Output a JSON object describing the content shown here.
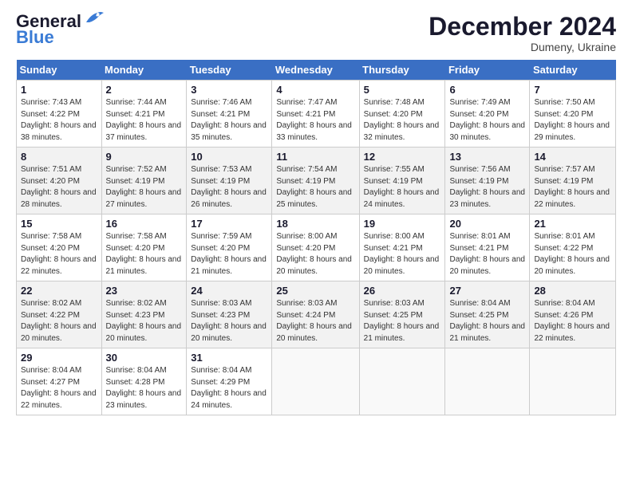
{
  "header": {
    "logo_line1": "General",
    "logo_line2": "Blue",
    "month": "December 2024",
    "location": "Dumeny, Ukraine"
  },
  "weekdays": [
    "Sunday",
    "Monday",
    "Tuesday",
    "Wednesday",
    "Thursday",
    "Friday",
    "Saturday"
  ],
  "weeks": [
    [
      {
        "day": "1",
        "sunrise": "7:43 AM",
        "sunset": "4:22 PM",
        "daylight": "8 hours and 38 minutes."
      },
      {
        "day": "2",
        "sunrise": "7:44 AM",
        "sunset": "4:21 PM",
        "daylight": "8 hours and 37 minutes."
      },
      {
        "day": "3",
        "sunrise": "7:46 AM",
        "sunset": "4:21 PM",
        "daylight": "8 hours and 35 minutes."
      },
      {
        "day": "4",
        "sunrise": "7:47 AM",
        "sunset": "4:21 PM",
        "daylight": "8 hours and 33 minutes."
      },
      {
        "day": "5",
        "sunrise": "7:48 AM",
        "sunset": "4:20 PM",
        "daylight": "8 hours and 32 minutes."
      },
      {
        "day": "6",
        "sunrise": "7:49 AM",
        "sunset": "4:20 PM",
        "daylight": "8 hours and 30 minutes."
      },
      {
        "day": "7",
        "sunrise": "7:50 AM",
        "sunset": "4:20 PM",
        "daylight": "8 hours and 29 minutes."
      }
    ],
    [
      {
        "day": "8",
        "sunrise": "7:51 AM",
        "sunset": "4:20 PM",
        "daylight": "8 hours and 28 minutes."
      },
      {
        "day": "9",
        "sunrise": "7:52 AM",
        "sunset": "4:19 PM",
        "daylight": "8 hours and 27 minutes."
      },
      {
        "day": "10",
        "sunrise": "7:53 AM",
        "sunset": "4:19 PM",
        "daylight": "8 hours and 26 minutes."
      },
      {
        "day": "11",
        "sunrise": "7:54 AM",
        "sunset": "4:19 PM",
        "daylight": "8 hours and 25 minutes."
      },
      {
        "day": "12",
        "sunrise": "7:55 AM",
        "sunset": "4:19 PM",
        "daylight": "8 hours and 24 minutes."
      },
      {
        "day": "13",
        "sunrise": "7:56 AM",
        "sunset": "4:19 PM",
        "daylight": "8 hours and 23 minutes."
      },
      {
        "day": "14",
        "sunrise": "7:57 AM",
        "sunset": "4:19 PM",
        "daylight": "8 hours and 22 minutes."
      }
    ],
    [
      {
        "day": "15",
        "sunrise": "7:58 AM",
        "sunset": "4:20 PM",
        "daylight": "8 hours and 22 minutes."
      },
      {
        "day": "16",
        "sunrise": "7:58 AM",
        "sunset": "4:20 PM",
        "daylight": "8 hours and 21 minutes."
      },
      {
        "day": "17",
        "sunrise": "7:59 AM",
        "sunset": "4:20 PM",
        "daylight": "8 hours and 21 minutes."
      },
      {
        "day": "18",
        "sunrise": "8:00 AM",
        "sunset": "4:20 PM",
        "daylight": "8 hours and 20 minutes."
      },
      {
        "day": "19",
        "sunrise": "8:00 AM",
        "sunset": "4:21 PM",
        "daylight": "8 hours and 20 minutes."
      },
      {
        "day": "20",
        "sunrise": "8:01 AM",
        "sunset": "4:21 PM",
        "daylight": "8 hours and 20 minutes."
      },
      {
        "day": "21",
        "sunrise": "8:01 AM",
        "sunset": "4:22 PM",
        "daylight": "8 hours and 20 minutes."
      }
    ],
    [
      {
        "day": "22",
        "sunrise": "8:02 AM",
        "sunset": "4:22 PM",
        "daylight": "8 hours and 20 minutes."
      },
      {
        "day": "23",
        "sunrise": "8:02 AM",
        "sunset": "4:23 PM",
        "daylight": "8 hours and 20 minutes."
      },
      {
        "day": "24",
        "sunrise": "8:03 AM",
        "sunset": "4:23 PM",
        "daylight": "8 hours and 20 minutes."
      },
      {
        "day": "25",
        "sunrise": "8:03 AM",
        "sunset": "4:24 PM",
        "daylight": "8 hours and 20 minutes."
      },
      {
        "day": "26",
        "sunrise": "8:03 AM",
        "sunset": "4:25 PM",
        "daylight": "8 hours and 21 minutes."
      },
      {
        "day": "27",
        "sunrise": "8:04 AM",
        "sunset": "4:25 PM",
        "daylight": "8 hours and 21 minutes."
      },
      {
        "day": "28",
        "sunrise": "8:04 AM",
        "sunset": "4:26 PM",
        "daylight": "8 hours and 22 minutes."
      }
    ],
    [
      {
        "day": "29",
        "sunrise": "8:04 AM",
        "sunset": "4:27 PM",
        "daylight": "8 hours and 22 minutes."
      },
      {
        "day": "30",
        "sunrise": "8:04 AM",
        "sunset": "4:28 PM",
        "daylight": "8 hours and 23 minutes."
      },
      {
        "day": "31",
        "sunrise": "8:04 AM",
        "sunset": "4:29 PM",
        "daylight": "8 hours and 24 minutes."
      },
      null,
      null,
      null,
      null
    ]
  ]
}
